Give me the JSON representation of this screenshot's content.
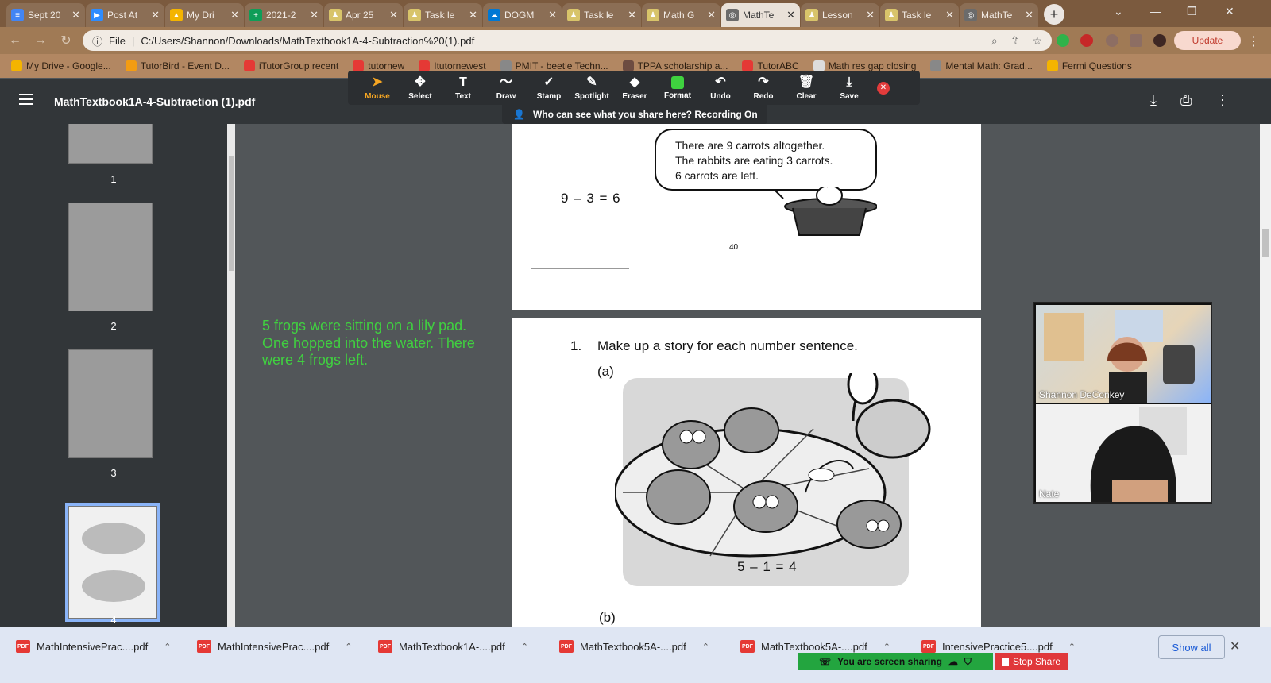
{
  "browser": {
    "tabs": [
      {
        "label": "Sept 20",
        "color": "#4285f4",
        "glyph": "≡"
      },
      {
        "label": "Post At",
        "color": "#2d8cff",
        "glyph": "▶"
      },
      {
        "label": "My Dri",
        "color": "#f4b400",
        "glyph": "▲"
      },
      {
        "label": "2021-2",
        "color": "#0f9d58",
        "glyph": "+"
      },
      {
        "label": "Apr 25",
        "color": "#d8c46a",
        "glyph": "♟"
      },
      {
        "label": "Task le",
        "color": "#d8c46a",
        "glyph": "♟"
      },
      {
        "label": "DOGM",
        "color": "#0078d4",
        "glyph": "☁"
      },
      {
        "label": "Task le",
        "color": "#d8c46a",
        "glyph": "♟"
      },
      {
        "label": "Math G",
        "color": "#d8c46a",
        "glyph": "♟"
      },
      {
        "label": "MathTe",
        "color": "#6b6b6b",
        "glyph": "◎",
        "active": true
      },
      {
        "label": "Lesson",
        "color": "#d8c46a",
        "glyph": "♟"
      },
      {
        "label": "Task le",
        "color": "#d8c46a",
        "glyph": "♟"
      },
      {
        "label": "MathTe",
        "color": "#6b6b6b",
        "glyph": "◎"
      }
    ],
    "address": {
      "scheme_label": "File",
      "url": "C:/Users/Shannon/Downloads/MathTextbook1A-4-Subtraction%20(1).pdf"
    },
    "update_label": "Update",
    "bookmarks": [
      {
        "label": "My Drive - Google...",
        "color": "#f4b400"
      },
      {
        "label": "TutorBird - Event D...",
        "color": "#f39c12"
      },
      {
        "label": "iTutorGroup recent",
        "color": "#e53935"
      },
      {
        "label": "tutornew",
        "color": "#e53935"
      },
      {
        "label": "Itutornewest",
        "color": "#e53935"
      },
      {
        "label": "PMIT - beetle Techn...",
        "color": "#888888"
      },
      {
        "label": "TPPA scholarship a...",
        "color": "#6d4c41"
      },
      {
        "label": "TutorABC",
        "color": "#e53935"
      },
      {
        "label": "Math res gap closing",
        "color": "#dddddd"
      },
      {
        "label": "Mental Math: Grad...",
        "color": "#888888"
      },
      {
        "label": "Fermi Questions",
        "color": "#f4b400"
      }
    ]
  },
  "pdf_viewer": {
    "title": "MathTextbook1A-4-Subtraction (1).pdf",
    "thumbnails": [
      {
        "page": "1"
      },
      {
        "page": "2"
      },
      {
        "page": "3"
      },
      {
        "page": "4"
      }
    ]
  },
  "annotation_toolbar": {
    "tools": [
      {
        "label": "Mouse",
        "glyph": "➤",
        "active": true
      },
      {
        "label": "Select",
        "glyph": "✥"
      },
      {
        "label": "Text",
        "glyph": "T"
      },
      {
        "label": "Draw",
        "glyph": "〜"
      },
      {
        "label": "Stamp",
        "glyph": "✓"
      },
      {
        "label": "Spotlight",
        "glyph": "✎"
      },
      {
        "label": "Eraser",
        "glyph": "◆"
      },
      {
        "label": "Format",
        "glyph": ""
      },
      {
        "label": "Undo",
        "glyph": "↶"
      },
      {
        "label": "Redo",
        "glyph": "↷"
      },
      {
        "label": "Clear",
        "glyph": "🗑"
      },
      {
        "label": "Save",
        "glyph": "⤓"
      }
    ],
    "share_banner": "Who can see what you share here? Recording On"
  },
  "document": {
    "page40": {
      "bubble_lines": [
        "There are 9 carrots altogether.",
        "The rabbits are eating 3 carrots.",
        "6 carrots are left."
      ],
      "equation": "9  –  3  =  6",
      "page_number": "40"
    },
    "page41": {
      "question_number": "1.",
      "question_text": "Make up a story for each number sentence.",
      "part_a": "(a)",
      "equation_a": "5  –  1  =  4",
      "part_b": "(b)"
    }
  },
  "annotation_note": "5 frogs were sitting on a lily pad.  One hopped into the water.  There were 4 frogs left.",
  "video": {
    "participants": [
      {
        "name": "Shannon DeConkey"
      },
      {
        "name": "Nate"
      }
    ]
  },
  "downloads": {
    "items": [
      {
        "label": "MathIntensivePrac....pdf"
      },
      {
        "label": "MathIntensivePrac....pdf"
      },
      {
        "label": "MathTextbook1A-....pdf"
      },
      {
        "label": "MathTextbook5A-....pdf"
      },
      {
        "label": "MathTextbook5A-....pdf"
      },
      {
        "label": "IntensivePractice5....pdf"
      }
    ],
    "show_all": "Show all"
  },
  "screen_share": {
    "status": "You are screen sharing",
    "stop_label": "Stop Share"
  }
}
